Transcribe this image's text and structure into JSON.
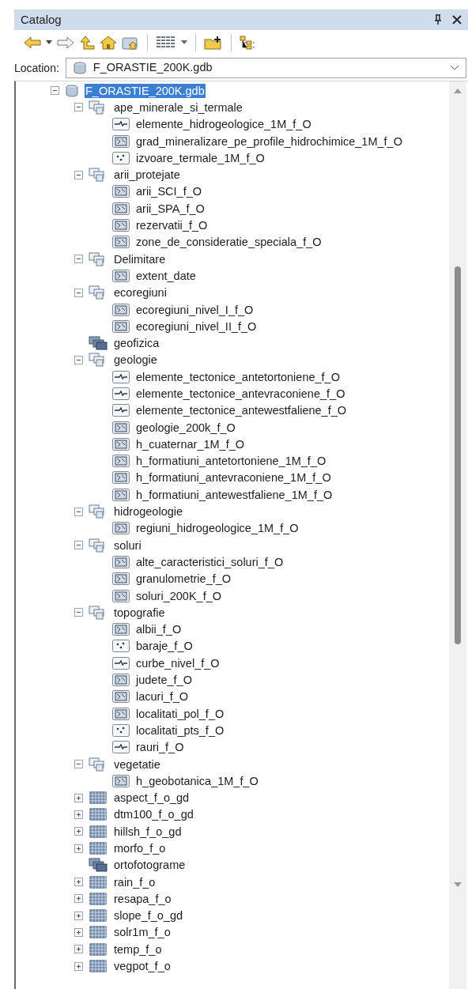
{
  "panel": {
    "title": "Catalog"
  },
  "location": {
    "label": "Location:",
    "value": "F_ORASTIE_200K.gdb"
  },
  "tree": [
    {
      "label": "F_ORASTIE_200K.gdb",
      "kind": "geodatabase",
      "expanded": true,
      "selected": true,
      "children": [
        {
          "label": "ape_minerale_si_termale",
          "kind": "dataset",
          "expanded": true,
          "selected": false,
          "children": [
            {
              "label": "elemente_hidrogeologice_1M_f_O",
              "kind": "line",
              "selected": false
            },
            {
              "label": "grad_mineralizare_pe_profile_hidrochimice_1M_f_O",
              "kind": "polygon",
              "selected": false
            },
            {
              "label": "izvoare_termale_1M_f_O",
              "kind": "point",
              "selected": false
            }
          ]
        },
        {
          "label": "arii_protejate",
          "kind": "dataset",
          "expanded": true,
          "selected": false,
          "children": [
            {
              "label": "arii_SCI_f_O",
              "kind": "polygon",
              "selected": false
            },
            {
              "label": "arii_SPA_f_O",
              "kind": "polygon",
              "selected": false
            },
            {
              "label": "rezervatii_f_O",
              "kind": "polygon",
              "selected": false
            },
            {
              "label": "zone_de_consideratie_speciala_f_O",
              "kind": "polygon",
              "selected": false
            }
          ]
        },
        {
          "label": "Delimitare",
          "kind": "dataset",
          "expanded": true,
          "selected": false,
          "children": [
            {
              "label": "extent_date",
              "kind": "polygon",
              "selected": false
            }
          ]
        },
        {
          "label": "ecoregiuni",
          "kind": "dataset",
          "expanded": true,
          "selected": false,
          "children": [
            {
              "label": "ecoregiuni_nivel_I_f_O",
              "kind": "polygon",
              "selected": false
            },
            {
              "label": "ecoregiuni_nivel_II_f_O",
              "kind": "polygon",
              "selected": false
            }
          ]
        },
        {
          "label": "geofizica",
          "kind": "catalog",
          "selected": false
        },
        {
          "label": "geologie",
          "kind": "dataset",
          "expanded": true,
          "selected": false,
          "children": [
            {
              "label": "elemente_tectonice_antetortoniene_f_O",
              "kind": "line",
              "selected": false
            },
            {
              "label": "elemente_tectonice_antevraconiene_f_O",
              "kind": "line",
              "selected": false
            },
            {
              "label": "elemente_tectonice_antewestfaliene_f_O",
              "kind": "line",
              "selected": false
            },
            {
              "label": "geologie_200k_f_O",
              "kind": "polygon",
              "selected": false
            },
            {
              "label": "h_cuaternar_1M_f_O",
              "kind": "polygon",
              "selected": false
            },
            {
              "label": "h_formatiuni_antetortoniene_1M_f_O",
              "kind": "polygon",
              "selected": false
            },
            {
              "label": "h_formatiuni_antevraconiene_1M_f_O",
              "kind": "polygon",
              "selected": false
            },
            {
              "label": "h_formatiuni_antewestfaliene_1M_f_O",
              "kind": "polygon",
              "selected": false
            }
          ]
        },
        {
          "label": "hidrogeologie",
          "kind": "dataset",
          "expanded": true,
          "selected": false,
          "children": [
            {
              "label": "regiuni_hidrogeologice_1M_f_O",
              "kind": "polygon",
              "selected": false
            }
          ]
        },
        {
          "label": "soluri",
          "kind": "dataset",
          "expanded": true,
          "selected": false,
          "children": [
            {
              "label": "alte_caracteristici_soluri_f_O",
              "kind": "polygon",
              "selected": false
            },
            {
              "label": "granulometrie_f_O",
              "kind": "polygon",
              "selected": false
            },
            {
              "label": "soluri_200K_f_O",
              "kind": "polygon",
              "selected": false
            }
          ]
        },
        {
          "label": "topografie",
          "kind": "dataset",
          "expanded": true,
          "selected": false,
          "children": [
            {
              "label": "albii_f_O",
              "kind": "polygon",
              "selected": false
            },
            {
              "label": "baraje_f_O",
              "kind": "point",
              "selected": false
            },
            {
              "label": "curbe_nivel_f_O",
              "kind": "line",
              "selected": false
            },
            {
              "label": "judete_f_O",
              "kind": "polygon",
              "selected": false
            },
            {
              "label": "lacuri_f_O",
              "kind": "polygon",
              "selected": false
            },
            {
              "label": "localitati_pol_f_O",
              "kind": "polygon",
              "selected": false
            },
            {
              "label": "localitati_pts_f_O",
              "kind": "point",
              "selected": false
            },
            {
              "label": "rauri_f_O",
              "kind": "line",
              "selected": false
            }
          ]
        },
        {
          "label": "vegetatie",
          "kind": "dataset",
          "expanded": true,
          "selected": false,
          "children": [
            {
              "label": "h_geobotanica_1M_f_O",
              "kind": "polygon",
              "selected": false
            }
          ]
        },
        {
          "label": "aspect_f_o_gd",
          "kind": "raster",
          "expanded": false,
          "selected": false
        },
        {
          "label": "dtm100_f_o_gd",
          "kind": "raster",
          "expanded": false,
          "selected": false
        },
        {
          "label": "hillsh_f_o_gd",
          "kind": "raster",
          "expanded": false,
          "selected": false
        },
        {
          "label": "morfo_f_o",
          "kind": "raster",
          "expanded": false,
          "selected": false
        },
        {
          "label": "ortofotograme",
          "kind": "catalog",
          "selected": false
        },
        {
          "label": "rain_f_o",
          "kind": "raster",
          "expanded": false,
          "selected": false
        },
        {
          "label": "resapa_f_o",
          "kind": "raster",
          "expanded": false,
          "selected": false
        },
        {
          "label": "slope_f_o_gd",
          "kind": "raster",
          "expanded": false,
          "selected": false
        },
        {
          "label": "solr1m_f_o",
          "kind": "raster",
          "expanded": false,
          "selected": false
        },
        {
          "label": "temp_f_o",
          "kind": "raster",
          "expanded": false,
          "selected": false
        },
        {
          "label": "vegpot_f_o",
          "kind": "raster",
          "expanded": false,
          "selected": false
        }
      ]
    }
  ]
}
